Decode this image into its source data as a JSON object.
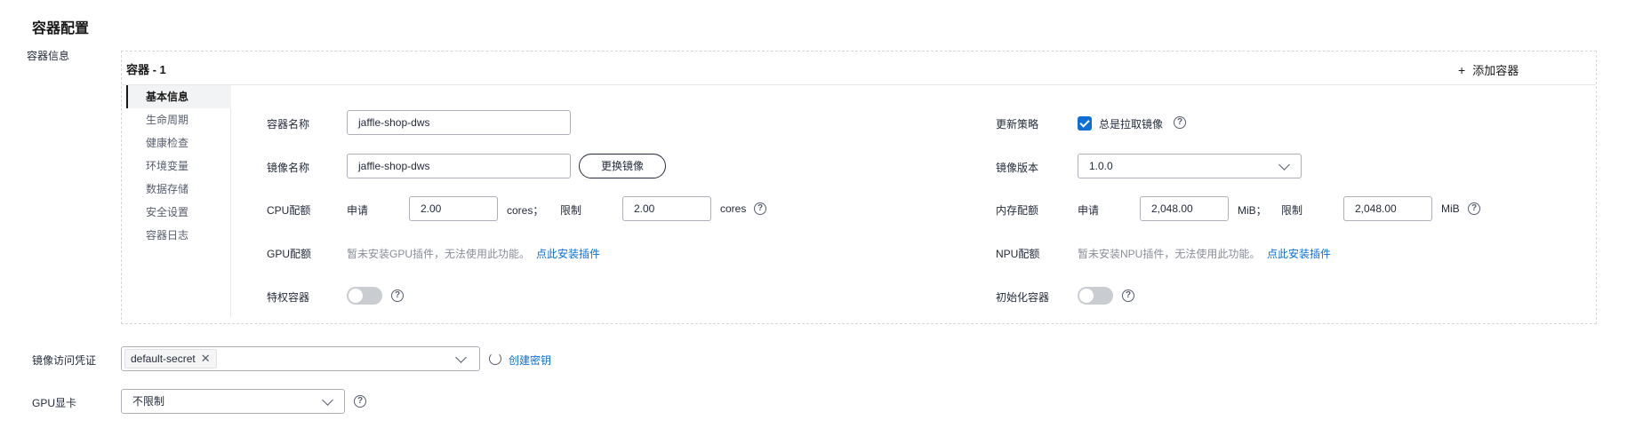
{
  "section": {
    "title": "容器配置"
  },
  "container_info": {
    "label": "容器信息",
    "tab_label": "容器 - 1",
    "add_button": "添加容器",
    "nav": [
      "基本信息",
      "生命周期",
      "健康检查",
      "环境变量",
      "数据存储",
      "安全设置",
      "容器日志"
    ],
    "active_nav_index": 0
  },
  "form": {
    "container_name": {
      "label": "容器名称",
      "value": "jaffle-shop-dws"
    },
    "image_name": {
      "label": "镜像名称",
      "value": "jaffle-shop-dws",
      "change_button": "更换镜像"
    },
    "cpu": {
      "label": "CPU配额",
      "request_label": "申请",
      "request_value": "2.00",
      "request_unit": "cores；",
      "limit_label": "限制",
      "limit_value": "2.00",
      "limit_unit": "cores"
    },
    "gpu": {
      "label": "GPU配额",
      "note": "暂未安装GPU插件，无法使用此功能。",
      "link": "点此安装插件"
    },
    "privileged": {
      "label": "特权容器",
      "enabled": false
    },
    "update_policy": {
      "label": "更新策略",
      "checkbox_label": "总是拉取镜像",
      "checked": true
    },
    "image_version": {
      "label": "镜像版本",
      "value": "1.0.0"
    },
    "memory": {
      "label": "内存配额",
      "request_label": "申请",
      "request_value": "2,048.00",
      "request_unit": "MiB；",
      "limit_label": "限制",
      "limit_value": "2,048.00",
      "limit_unit": "MiB"
    },
    "npu": {
      "label": "NPU配额",
      "note": "暂未安装NPU插件，无法使用此功能。",
      "link": "点此安装插件"
    },
    "init_container": {
      "label": "初始化容器",
      "enabled": false
    }
  },
  "image_credential": {
    "label": "镜像访问凭证",
    "tag": "default-secret",
    "create_link": "创建密钥"
  },
  "gpu_card": {
    "label": "GPU显卡",
    "value": "不限制"
  },
  "icons": {
    "help": "?",
    "plus": "+",
    "close": "✕"
  },
  "colors": {
    "accent": "#0d6fd6",
    "toggle_off": "#c9ccd1"
  }
}
